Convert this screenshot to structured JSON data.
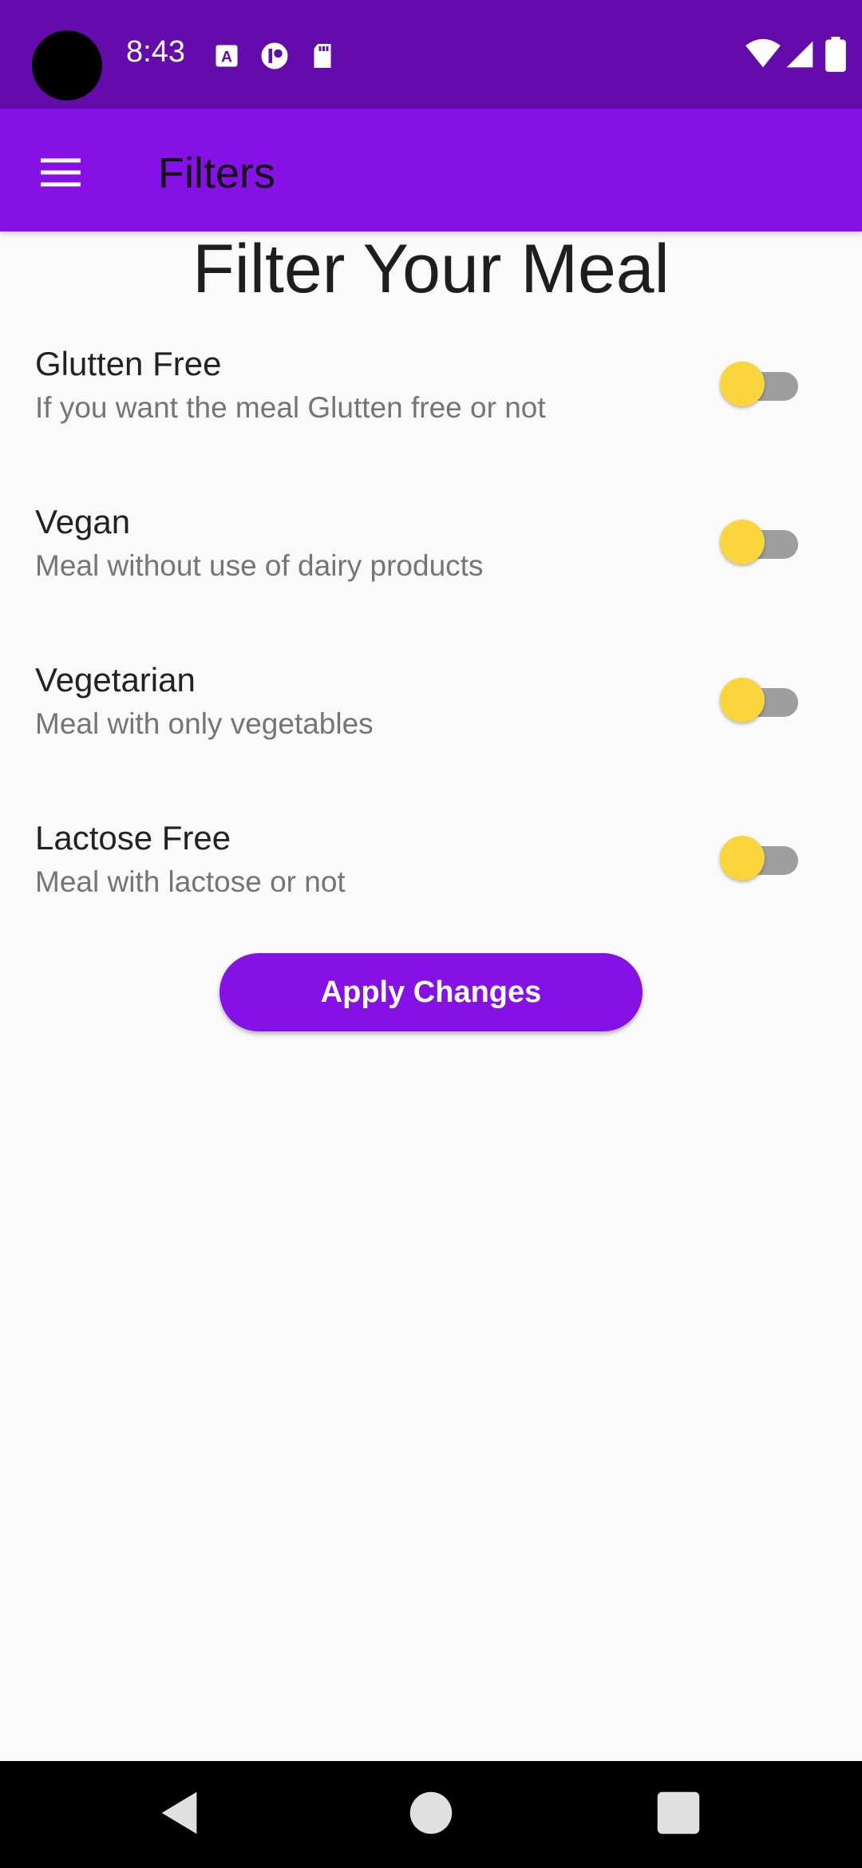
{
  "status_bar": {
    "time": "8:43",
    "icons": [
      "text-a-icon",
      "notification-circle-icon",
      "sd-card-icon",
      "wifi-icon",
      "signal-icon",
      "battery-icon"
    ]
  },
  "app_bar": {
    "title": "Filters",
    "menu_icon": "hamburger-menu-icon",
    "background": "#8611e6"
  },
  "page": {
    "heading": "Filter Your Meal"
  },
  "filters": [
    {
      "title": "Glutten Free",
      "subtitle": "If you want the meal Glutten free or not",
      "enabled": false
    },
    {
      "title": "Vegan",
      "subtitle": "Meal without use of dairy products",
      "enabled": false
    },
    {
      "title": "Vegetarian",
      "subtitle": "Meal with only vegetables",
      "enabled": false
    },
    {
      "title": "Lactose Free",
      "subtitle": "Meal with lactose or not",
      "enabled": false
    }
  ],
  "apply_button": {
    "label": "Apply Changes",
    "color": "#8611e6"
  },
  "switch_colors": {
    "thumb": "#fcd53c",
    "track": "#9e9e9e"
  },
  "nav_bar": {
    "icons": [
      "back-icon",
      "home-icon",
      "recents-icon"
    ]
  }
}
